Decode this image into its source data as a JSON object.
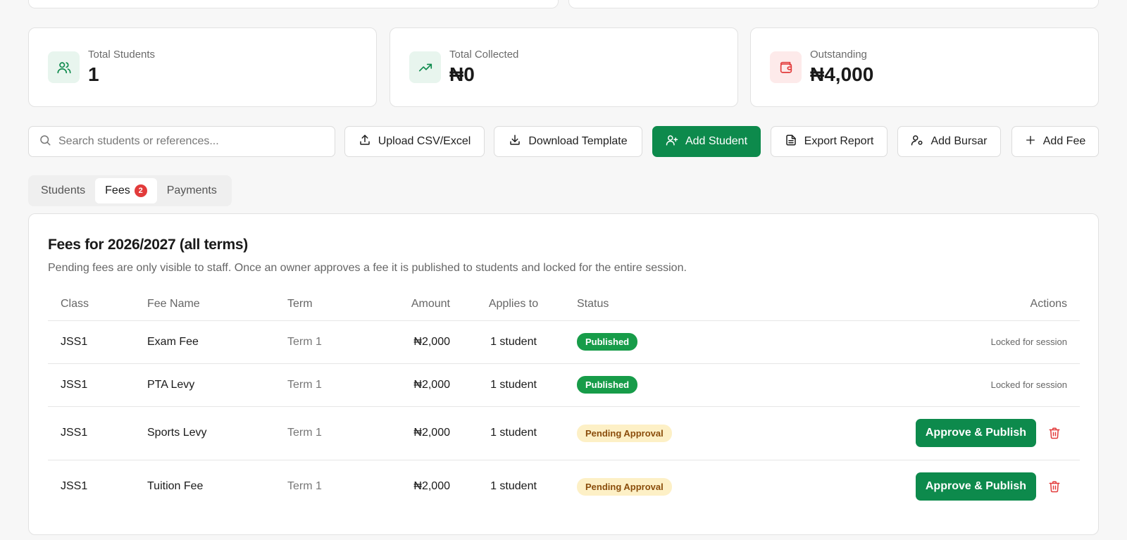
{
  "stats": [
    {
      "label": "Total Students",
      "value": "1",
      "icon": "users-icon",
      "color": "#0d8a4c",
      "bg": "#e8f5ee"
    },
    {
      "label": "Total Collected",
      "value": "₦0",
      "icon": "trending-up-icon",
      "color": "#0d8a4c",
      "bg": "#e8f5ee"
    },
    {
      "label": "Outstanding",
      "value": "₦4,000",
      "icon": "wallet-icon",
      "color": "#e23b3b",
      "bg": "#fdeaea"
    }
  ],
  "search": {
    "placeholder": "Search students or references..."
  },
  "toolbar": {
    "upload": "Upload CSV/Excel",
    "download": "Download Template",
    "add_student": "Add Student",
    "export": "Export Report",
    "add_bursar": "Add Bursar",
    "add_fee": "Add Fee"
  },
  "tabs": {
    "students": "Students",
    "fees": "Fees",
    "fees_badge": "2",
    "payments": "Payments"
  },
  "panel": {
    "title": "Fees for 2026/2027 (all terms)",
    "description": "Pending fees are only visible to staff. Once an owner approves a fee it is published to students and locked for the entire session."
  },
  "table": {
    "headers": {
      "class": "Class",
      "fee_name": "Fee Name",
      "term": "Term",
      "amount": "Amount",
      "applies_to": "Applies to",
      "status": "Status",
      "actions": "Actions"
    },
    "rows": [
      {
        "class": "JSS1",
        "fee_name": "Exam Fee",
        "term": "Term 1",
        "amount": "₦2,000",
        "applies_to": "1 student",
        "status": "Published",
        "action": "Locked for session"
      },
      {
        "class": "JSS1",
        "fee_name": "PTA Levy",
        "term": "Term 1",
        "amount": "₦2,000",
        "applies_to": "1 student",
        "status": "Published",
        "action": "Locked for session"
      },
      {
        "class": "JSS1",
        "fee_name": "Sports Levy",
        "term": "Term 1",
        "amount": "₦2,000",
        "applies_to": "1 student",
        "status": "Pending Approval",
        "action": "Approve & Publish"
      },
      {
        "class": "JSS1",
        "fee_name": "Tuition Fee",
        "term": "Term 1",
        "amount": "₦2,000",
        "applies_to": "1 student",
        "status": "Pending Approval",
        "action": "Approve & Publish"
      }
    ]
  }
}
